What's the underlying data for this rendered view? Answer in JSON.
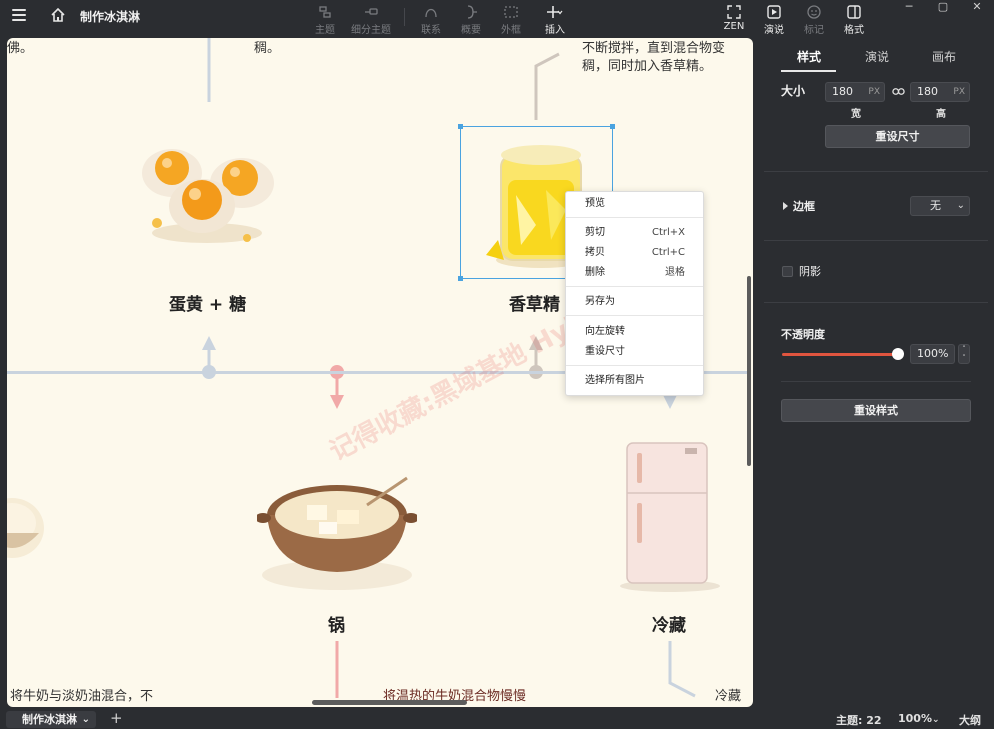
{
  "app": {
    "title": "制作冰淇淋"
  },
  "toolbar": {
    "items": [
      {
        "label": "主题",
        "icon": "topic-icon"
      },
      {
        "label": "细分主题",
        "icon": "subtopic-icon"
      },
      {
        "label": "联系",
        "icon": "relationship-icon"
      },
      {
        "label": "概要",
        "icon": "summary-icon"
      },
      {
        "label": "外框",
        "icon": "boundary-icon"
      },
      {
        "label": "插入",
        "icon": "plus-icon"
      }
    ],
    "right_items": [
      {
        "label": "ZEN",
        "icon": "zen-icon"
      },
      {
        "label": "演说",
        "icon": "pitch-icon"
      },
      {
        "label": "标记",
        "icon": "marker-icon"
      },
      {
        "label": "格式",
        "icon": "format-icon"
      }
    ]
  },
  "canvas": {
    "texts": {
      "top_left_fragment": "佛。",
      "top_mid_fragment": "稠。",
      "top_right_line1": "不断搅拌，直到混合物变",
      "top_right_line2": "稠，同时加入香草精。",
      "bottom_left_fragment": "将牛奶与淡奶油混合，不",
      "bottom_mid_fragment": "将温热的牛奶混合物慢慢",
      "bottom_right_fragment": "冷藏"
    },
    "nodes": [
      {
        "title": "蛋黄 + 糖",
        "image": "egg-yolks-image"
      },
      {
        "title": "香草精",
        "image": "vanilla-jar-image"
      },
      {
        "title": "锅",
        "image": "pot-image"
      },
      {
        "title": "冷藏",
        "image": "fridge-image"
      }
    ],
    "watermark": "记得收藏:黑域基地 Hybase.com"
  },
  "context_menu": {
    "items": [
      {
        "label": "预览",
        "shortcut": ""
      },
      {
        "label": "剪切",
        "shortcut": "Ctrl+X"
      },
      {
        "label": "拷贝",
        "shortcut": "Ctrl+C"
      },
      {
        "label": "删除",
        "shortcut": "退格"
      },
      {
        "label": "另存为",
        "shortcut": ""
      },
      {
        "label": "向左旋转",
        "shortcut": ""
      },
      {
        "label": "重设尺寸",
        "shortcut": ""
      },
      {
        "label": "选择所有图片",
        "shortcut": ""
      }
    ]
  },
  "panel": {
    "tabs": [
      "样式",
      "演说",
      "画布"
    ],
    "size_label": "大小",
    "width_value": "180",
    "height_value": "180",
    "unit": "PX",
    "width_label": "宽",
    "height_label": "高",
    "reset_size_button": "重设尺寸",
    "border_label": "边框",
    "border_value": "无",
    "shadow_label": "阴影",
    "opacity_label": "不透明度",
    "opacity_value": "100%",
    "opacity_fraction": 1.0,
    "reset_style_button": "重设样式"
  },
  "bottombar": {
    "sheet_tab": "制作冰淇淋",
    "topic_count": "主题: 22",
    "zoom": "100%",
    "outline_label": "大纲"
  },
  "colors": {
    "canvas_bg": "#fdf9ec",
    "timeline": "#c9d3de",
    "accent_red": "#e0553f",
    "selection": "#4aa3e0"
  }
}
